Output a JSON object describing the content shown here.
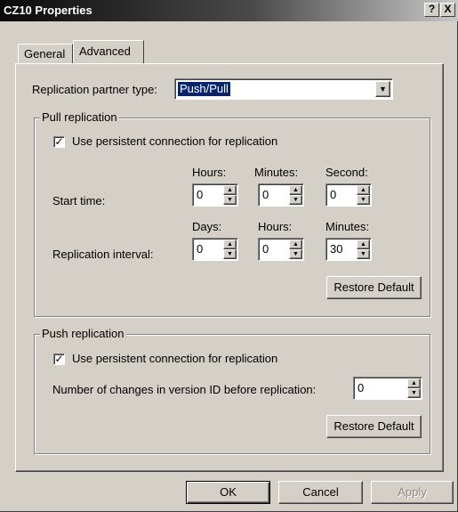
{
  "window": {
    "title": "CZ10 Properties",
    "help_glyph": "?",
    "close_glyph": "X"
  },
  "tabs": [
    {
      "label": "General"
    },
    {
      "label": "Advanced"
    }
  ],
  "replication_partner": {
    "label": "Replication partner type:",
    "value": "Push/Pull"
  },
  "pull": {
    "group_label": "Pull replication",
    "persistent_label": "Use persistent connection for replication",
    "persistent_checked": true,
    "start_time_label": "Start time:",
    "start_time_headers": [
      "Hours:",
      "Minutes:",
      "Second:"
    ],
    "start_time_values": [
      "0",
      "0",
      "0"
    ],
    "interval_label": "Replication interval:",
    "interval_headers": [
      "Days:",
      "Hours:",
      "Minutes:"
    ],
    "interval_values": [
      "0",
      "0",
      "30"
    ],
    "restore_label": "Restore Default"
  },
  "push": {
    "group_label": "Push replication",
    "persistent_label": "Use persistent connection for replication",
    "persistent_checked": true,
    "changes_label": "Number of changes in version ID before replication:",
    "changes_value": "0",
    "restore_label": "Restore Default"
  },
  "buttons": {
    "ok": "OK",
    "cancel": "Cancel",
    "apply": "Apply"
  },
  "colors": {
    "face": "#d4d0c8",
    "selection": "#0a246a"
  }
}
